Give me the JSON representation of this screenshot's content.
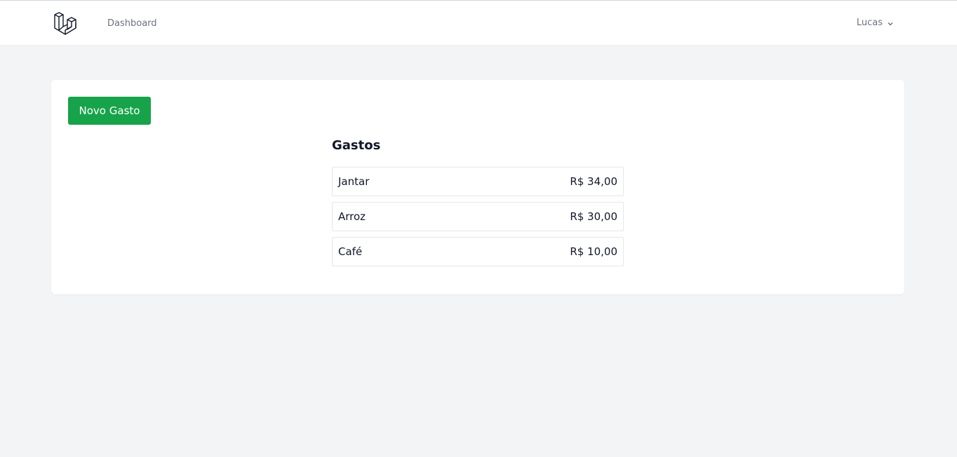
{
  "header": {
    "logo_icon": "laravel-logo-icon",
    "nav": {
      "dashboard_label": "Dashboard"
    },
    "user": {
      "name": "Lucas",
      "menu_icon": "chevron-down-icon"
    }
  },
  "main": {
    "new_button_label": "Novo Gasto",
    "section_title": "Gastos",
    "expenses": [
      {
        "name": "Jantar",
        "amount": "R$ 34,00"
      },
      {
        "name": "Arroz",
        "amount": "R$ 30,00"
      },
      {
        "name": "Café",
        "amount": "R$ 10,00"
      }
    ]
  },
  "colors": {
    "page_background": "#f3f4f6",
    "card_background": "#ffffff",
    "primary_button": "#16a34a",
    "muted_text": "#6b7280"
  }
}
